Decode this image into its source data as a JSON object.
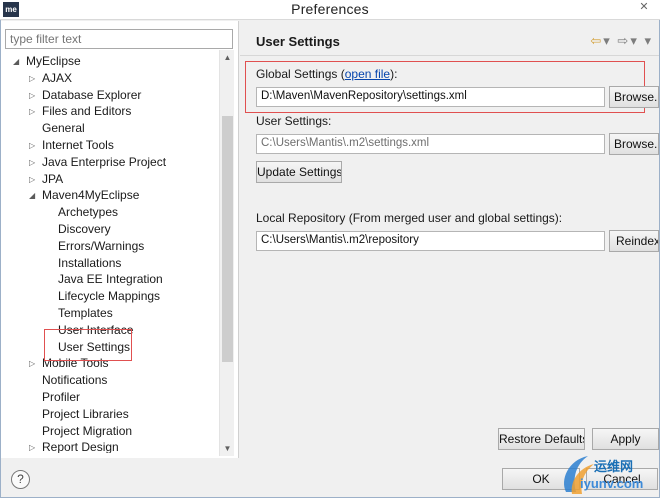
{
  "window": {
    "app_icon_text": "me",
    "title": "Preferences"
  },
  "filter": {
    "placeholder": "type filter text"
  },
  "tree": [
    {
      "label": "MyEclipse",
      "depth": 0,
      "expander": "expanded"
    },
    {
      "label": "AJAX",
      "depth": 1,
      "expander": "collapsed"
    },
    {
      "label": "Database Explorer",
      "depth": 1,
      "expander": "collapsed"
    },
    {
      "label": "Files and Editors",
      "depth": 1,
      "expander": "collapsed"
    },
    {
      "label": "General",
      "depth": 1,
      "expander": "none"
    },
    {
      "label": "Internet Tools",
      "depth": 1,
      "expander": "collapsed"
    },
    {
      "label": "Java Enterprise Project",
      "depth": 1,
      "expander": "collapsed"
    },
    {
      "label": "JPA",
      "depth": 1,
      "expander": "collapsed"
    },
    {
      "label": "Maven4MyEclipse",
      "depth": 1,
      "expander": "expanded"
    },
    {
      "label": "Archetypes",
      "depth": 2,
      "expander": "none"
    },
    {
      "label": "Discovery",
      "depth": 2,
      "expander": "none"
    },
    {
      "label": "Errors/Warnings",
      "depth": 2,
      "expander": "none"
    },
    {
      "label": "Installations",
      "depth": 2,
      "expander": "none"
    },
    {
      "label": "Java EE Integration",
      "depth": 2,
      "expander": "none"
    },
    {
      "label": "Lifecycle Mappings",
      "depth": 2,
      "expander": "none"
    },
    {
      "label": "Templates",
      "depth": 2,
      "expander": "none"
    },
    {
      "label": "User Interface",
      "depth": 2,
      "expander": "none"
    },
    {
      "label": "User Settings",
      "depth": 2,
      "expander": "none"
    },
    {
      "label": "Mobile Tools",
      "depth": 1,
      "expander": "collapsed"
    },
    {
      "label": "Notifications",
      "depth": 1,
      "expander": "none"
    },
    {
      "label": "Profiler",
      "depth": 1,
      "expander": "none"
    },
    {
      "label": "Project Libraries",
      "depth": 1,
      "expander": "none"
    },
    {
      "label": "Project Migration",
      "depth": 1,
      "expander": "none"
    },
    {
      "label": "Report Design",
      "depth": 1,
      "expander": "collapsed"
    }
  ],
  "page": {
    "title": "User Settings",
    "global_label": "Global Settings (",
    "global_link": "open file",
    "global_label_end": "):",
    "global_value": "D:\\Maven\\MavenRepository\\settings.xml",
    "browse_label": "Browse...",
    "user_label": "User Settings:",
    "user_value": "C:\\Users\\Mantis\\.m2\\settings.xml",
    "update_label": "Update Settings",
    "local_label": "Local Repository (From merged user and global settings):",
    "local_value": "C:\\Users\\Mantis\\.m2\\repository",
    "reindex_label": "Reindex",
    "restore_label": "Restore Defaults",
    "apply_label": "Apply"
  },
  "footer": {
    "help_icon": "?",
    "ok_label": "OK",
    "cancel_label": "Cancel"
  },
  "watermark": {
    "brand": "运维网",
    "url": "iyunv.com"
  },
  "colors": {
    "highlight_border": "#e05050",
    "link": "#0645ad"
  }
}
